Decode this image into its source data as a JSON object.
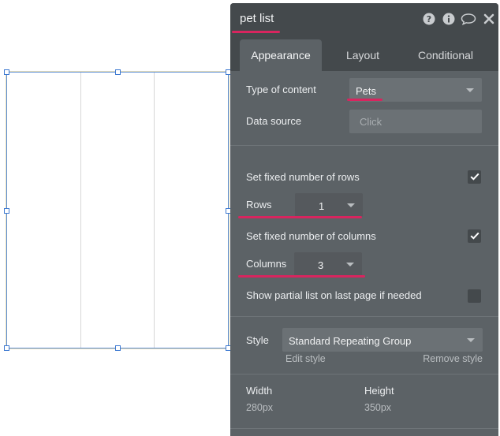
{
  "canvas": {
    "repeating_group": {
      "columns_shown": 3
    }
  },
  "panel": {
    "title": "pet list",
    "header_icons": [
      "help-icon",
      "info-icon",
      "comment-icon",
      "close-icon"
    ],
    "tabs": [
      {
        "label": "Appearance",
        "active": true
      },
      {
        "label": "Layout",
        "active": false
      },
      {
        "label": "Conditional",
        "active": false
      }
    ],
    "type_of_content": {
      "label": "Type of content",
      "value": "Pets"
    },
    "data_source": {
      "label": "Data source",
      "placeholder": "Click"
    },
    "fixed_rows": {
      "label": "Set fixed number of rows",
      "checked": true
    },
    "rows": {
      "label": "Rows",
      "value": "1"
    },
    "fixed_columns": {
      "label": "Set fixed number of columns",
      "checked": true
    },
    "columns": {
      "label": "Columns",
      "value": "3"
    },
    "partial_list": {
      "label": "Show partial list on last page if needed",
      "checked": false
    },
    "style": {
      "label": "Style",
      "value": "Standard Repeating Group",
      "edit_link": "Edit style",
      "remove_link": "Remove style"
    },
    "width": {
      "label": "Width",
      "value": "280px"
    },
    "height": {
      "label": "Height",
      "value": "350px"
    }
  },
  "colors": {
    "highlight": "#d8255f",
    "panel_bg": "#5c6266",
    "header_bg": "#44494c",
    "selection": "#3d79d1"
  }
}
